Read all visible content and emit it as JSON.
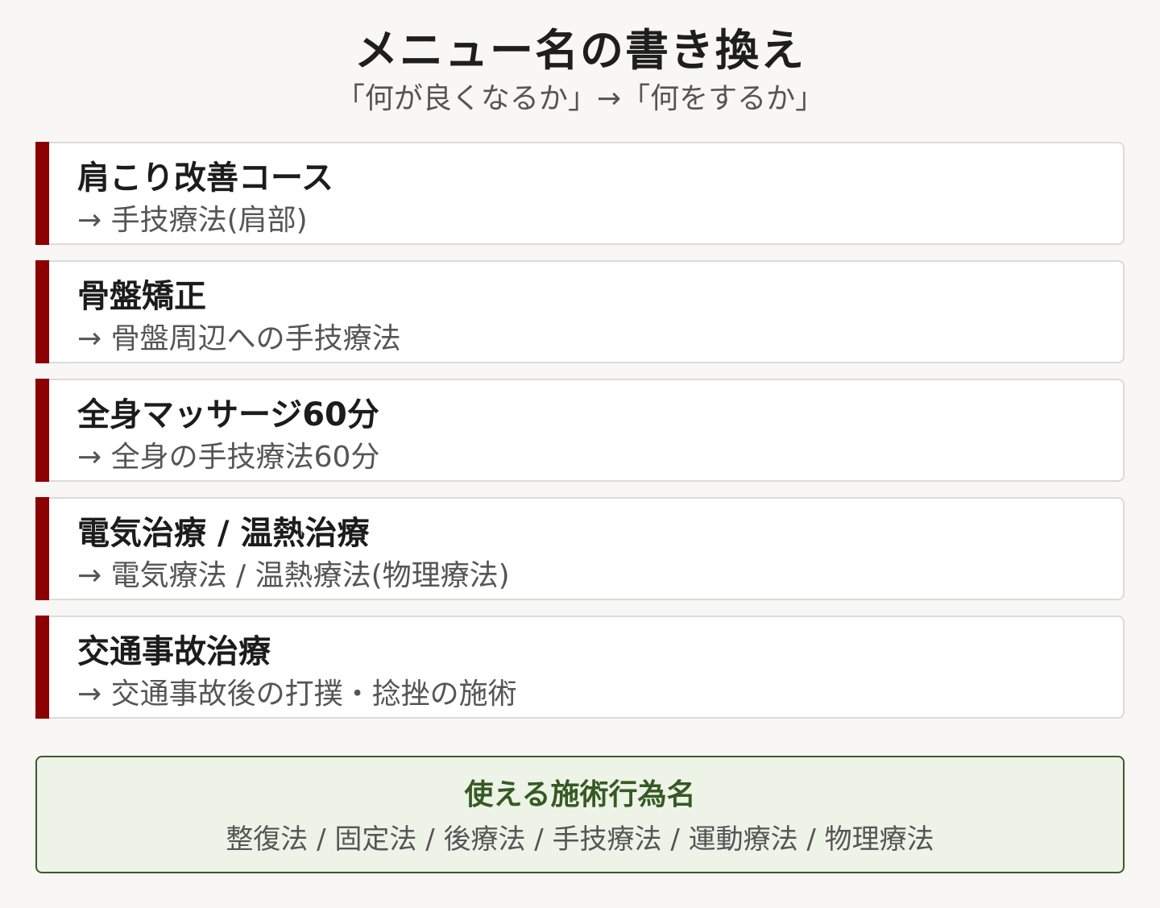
{
  "header": {
    "title": "メニュー名の書き換え",
    "subtitle": "「何が良くなるか」→「何をするか」"
  },
  "menu_items": [
    {
      "name": "肩こり改善コース",
      "rewrite": "→ 手技療法(肩部)"
    },
    {
      "name": "骨盤矯正",
      "rewrite": "→ 骨盤周辺への手技療法"
    },
    {
      "name": "全身マッサージ60分",
      "rewrite": "→ 全身の手技療法60分"
    },
    {
      "name": "電気治療 / 温熱治療",
      "rewrite": "→ 電気療法 / 温熱療法(物理療法)"
    },
    {
      "name": "交通事故治療",
      "rewrite": "→ 交通事故後の打撲・捻挫の施術"
    }
  ],
  "usable_terms": {
    "title": "使える施術行為名",
    "list": "整復法 / 固定法 / 後療法 / 手技療法 / 運動療法 / 物理療法"
  },
  "colors": {
    "accent_bar": "#8b0000",
    "usable_border": "#3d5a28",
    "usable_bg": "#eef3e8",
    "usable_title": "#355a23"
  }
}
